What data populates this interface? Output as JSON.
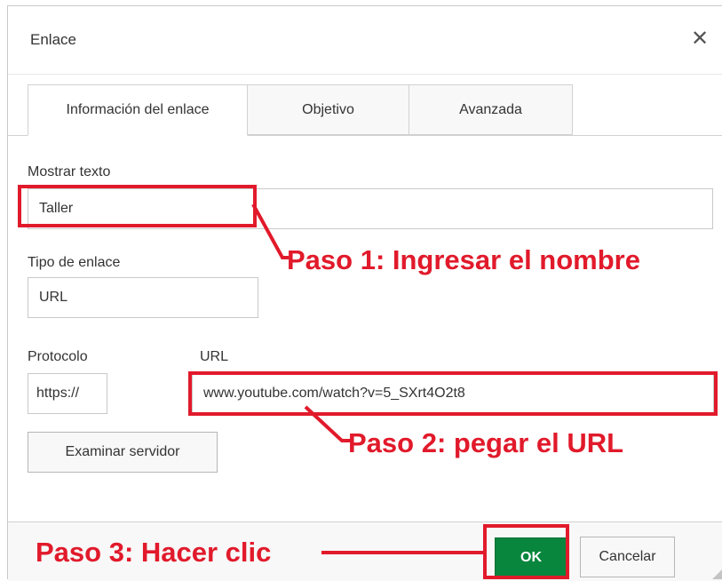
{
  "dialog": {
    "title": "Enlace",
    "close_icon": "close-icon"
  },
  "tabs": [
    {
      "label": "Información del enlace",
      "active": true
    },
    {
      "label": "Objetivo",
      "active": false
    },
    {
      "label": "Avanzada",
      "active": false
    }
  ],
  "form": {
    "display_text_label": "Mostrar texto",
    "display_text_value": "Taller",
    "link_type_label": "Tipo de enlace",
    "link_type_value": "URL",
    "protocol_label": "Protocolo",
    "protocol_value": "https://",
    "url_label": "URL",
    "url_value": "www.youtube.com/watch?v=5_SXrt4O2t8",
    "browse_server_label": "Examinar servidor"
  },
  "footer": {
    "ok_label": "OK",
    "cancel_label": "Cancelar"
  },
  "annotations": {
    "step1": "Paso 1: Ingresar el nombre",
    "step2": "Paso 2: pegar el URL",
    "step3": "Paso 3: Hacer clic"
  },
  "colors": {
    "annotation_red": "#e11a2b",
    "ok_green": "#09863e"
  }
}
